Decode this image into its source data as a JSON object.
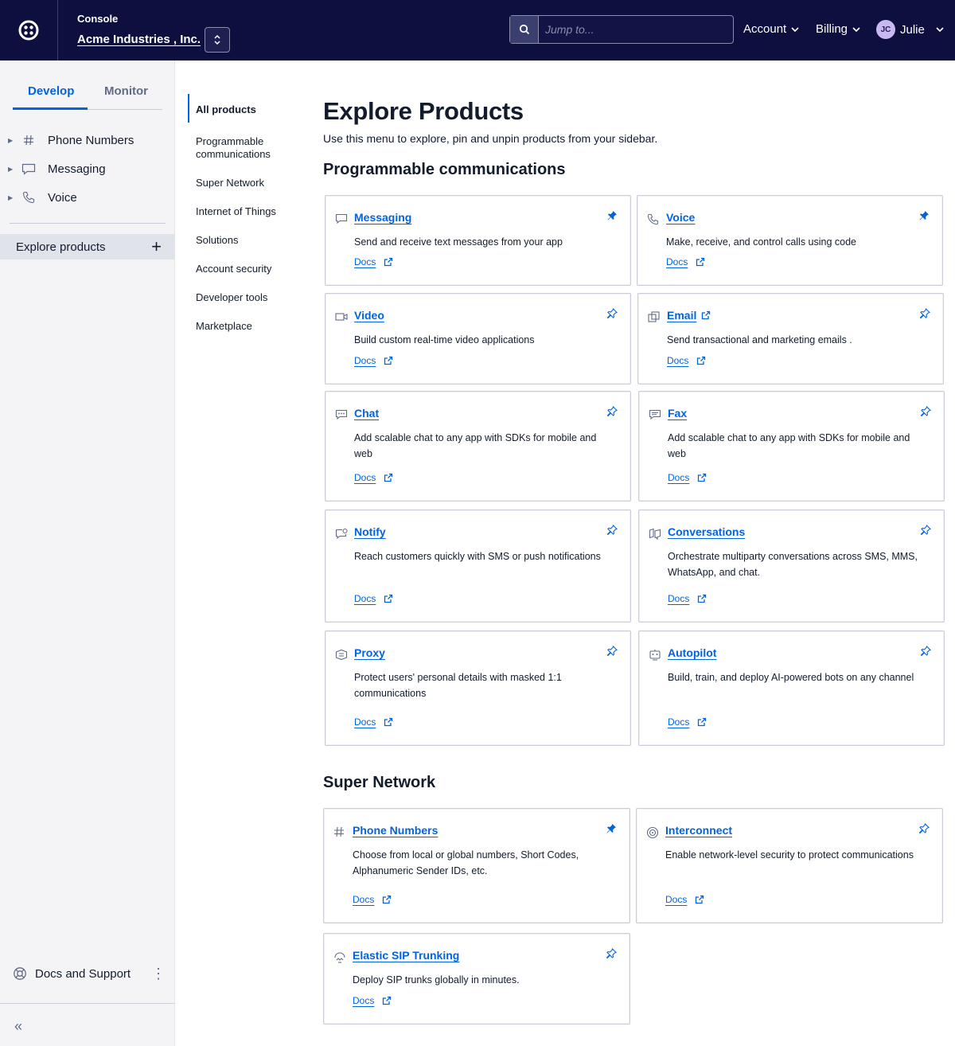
{
  "header": {
    "console_label": "Console",
    "account_name": "Acme Industries , Inc.",
    "search_placeholder": "Jump to...",
    "nav": {
      "account": "Account",
      "billing": "Billing",
      "user_initials": "JC",
      "user_name": "Julie"
    },
    "colors": {
      "bg": "#0d0f3e",
      "accent": "#0263e0"
    }
  },
  "sidebar": {
    "tabs": {
      "develop": "Develop",
      "monitor": "Monitor"
    },
    "items": [
      {
        "label": "Phone Numbers",
        "icon": "hash-icon"
      },
      {
        "label": "Messaging",
        "icon": "message-icon"
      },
      {
        "label": "Voice",
        "icon": "phone-icon"
      }
    ],
    "explore": "Explore products",
    "docs_support": "Docs and Support"
  },
  "subnav": {
    "items": [
      "All products",
      "Programmable communications",
      "Super Network",
      "Internet of Things",
      "Solutions",
      "Account security",
      "Developer tools",
      "Marketplace"
    ]
  },
  "main": {
    "title": "Explore Products",
    "subtitle": "Use this menu to explore, pin and unpin products from your sidebar.",
    "sections": [
      {
        "title": "Programmable communications",
        "cards": [
          {
            "title": "Messaging",
            "desc": "Send and receive text messages from your app",
            "docs": "Docs",
            "pinned": true,
            "icon": "message-icon"
          },
          {
            "title": "Voice",
            "desc": "Make, receive, and control calls using code",
            "docs": "Docs",
            "pinned": true,
            "icon": "phone-icon"
          },
          {
            "title": "Video",
            "desc": "Build custom real-time video applications",
            "docs": "Docs",
            "pinned": false,
            "icon": "video-icon"
          },
          {
            "title": "Email",
            "desc": "Send transactional and marketing emails .",
            "docs": "Docs",
            "pinned": false,
            "icon": "email-icon",
            "external": true
          },
          {
            "title": "Chat",
            "desc": "Add scalable chat to any app with SDKs for mobile and web",
            "docs": "Docs",
            "pinned": false,
            "icon": "chat-icon"
          },
          {
            "title": "Fax",
            "desc": "Add scalable chat to any app with SDKs for mobile and web",
            "docs": "Docs",
            "pinned": false,
            "icon": "fax-icon"
          },
          {
            "title": "Notify",
            "desc": "Reach customers quickly with SMS or push notifications",
            "docs": "Docs",
            "pinned": false,
            "icon": "notify-icon"
          },
          {
            "title": "Conversations",
            "desc": "Orchestrate multiparty conversations across SMS, MMS, WhatsApp, and chat.",
            "docs": "Docs",
            "pinned": false,
            "icon": "conversations-icon"
          },
          {
            "title": "Proxy",
            "desc": "Protect users' personal details with masked 1:1 communications",
            "docs": "Docs",
            "pinned": false,
            "icon": "proxy-icon"
          },
          {
            "title": "Autopilot",
            "desc": "Build, train, and deploy AI-powered bots on any channel",
            "docs": "Docs",
            "pinned": false,
            "icon": "autopilot-icon"
          }
        ]
      },
      {
        "title": "Super Network",
        "cards": [
          {
            "title": "Phone Numbers",
            "desc": "Choose from local or global numbers, Short Codes, Alphanumeric Sender IDs, etc.",
            "docs": "Docs",
            "pinned": true,
            "icon": "hash-icon"
          },
          {
            "title": "Interconnect",
            "desc": "Enable network-level security to protect communications",
            "docs": "Docs",
            "pinned": false,
            "icon": "interconnect-icon"
          },
          {
            "title": "Elastic SIP Trunking",
            "desc": "Deploy SIP trunks globally in minutes.",
            "docs": "Docs",
            "pinned": false,
            "icon": "sip-icon"
          }
        ]
      }
    ]
  }
}
